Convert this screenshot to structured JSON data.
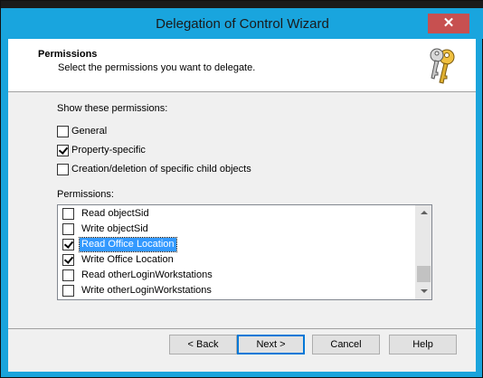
{
  "window": {
    "title": "Delegation of Control Wizard",
    "close_glyph": "✕"
  },
  "header": {
    "title": "Permissions",
    "subtitle": "Select the permissions you want to delegate.",
    "icon": "keys-icon"
  },
  "filters": {
    "label": "Show these permissions:",
    "options": [
      {
        "label": "General",
        "checked": false
      },
      {
        "label": "Property-specific",
        "checked": true
      },
      {
        "label": "Creation/deletion of specific child objects",
        "checked": false
      }
    ]
  },
  "permissions": {
    "label": "Permissions:",
    "items": [
      {
        "label": "Read objectSid",
        "checked": false,
        "selected": false
      },
      {
        "label": "Write objectSid",
        "checked": false,
        "selected": false
      },
      {
        "label": "Read Office Location",
        "checked": true,
        "selected": true
      },
      {
        "label": "Write Office Location",
        "checked": true,
        "selected": false
      },
      {
        "label": "Read otherLoginWorkstations",
        "checked": false,
        "selected": false
      },
      {
        "label": "Write otherLoginWorkstations",
        "checked": false,
        "selected": false
      }
    ]
  },
  "buttons": {
    "back": "< Back",
    "next": "Next >",
    "cancel": "Cancel",
    "help": "Help"
  },
  "colors": {
    "accent": "#1aa4dc",
    "selection": "#3399ff",
    "close": "#c75050"
  }
}
